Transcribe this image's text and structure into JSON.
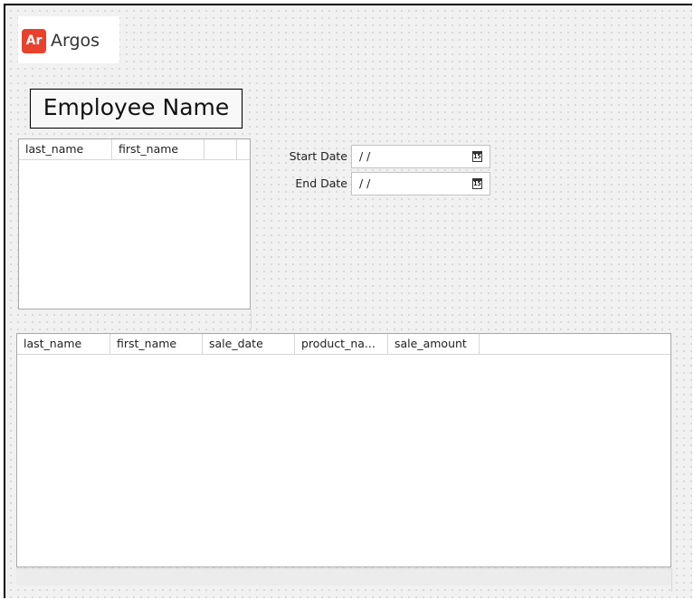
{
  "logo": {
    "badge": "Ar",
    "name": "Argos",
    "badge_color": "#e8412c"
  },
  "title": "Employee Name",
  "employee_grid": {
    "columns": [
      "last_name",
      "first_name",
      ""
    ],
    "rows": []
  },
  "filters": {
    "start_label": "Start Date",
    "start_value": "/ /",
    "end_label": "End Date",
    "end_value": "/ /",
    "calendar_glyph": "15"
  },
  "sales_grid": {
    "columns": [
      "last_name",
      "first_name",
      "sale_date",
      "product_na...",
      "sale_amount",
      ""
    ],
    "rows": []
  }
}
